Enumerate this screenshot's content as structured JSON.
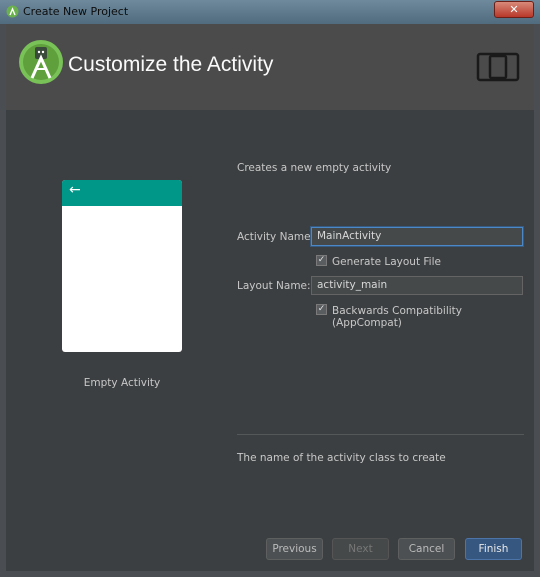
{
  "window": {
    "title": "Create New Project",
    "close_label": "✕"
  },
  "header": {
    "title": "Customize the Activity"
  },
  "preview": {
    "back_glyph": "←",
    "label": "Empty Activity"
  },
  "form": {
    "description": "Creates a new empty activity",
    "activity_name_label": "Activity Name:",
    "activity_name_value": "MainActivity",
    "generate_layout_label": "Generate Layout File",
    "generate_layout_checked": true,
    "layout_name_label": "Layout Name:",
    "layout_name_value": "activity_main",
    "backwards_compat_label": "Backwards Compatibility (AppCompat)",
    "backwards_compat_checked": true,
    "help_text": "The name of the activity class to create"
  },
  "buttons": {
    "previous": "Previous",
    "next": "Next",
    "cancel": "Cancel",
    "finish": "Finish"
  },
  "colors": {
    "accent": "#009688",
    "android_green": "#a4c639",
    "primary_button": "#365880"
  }
}
